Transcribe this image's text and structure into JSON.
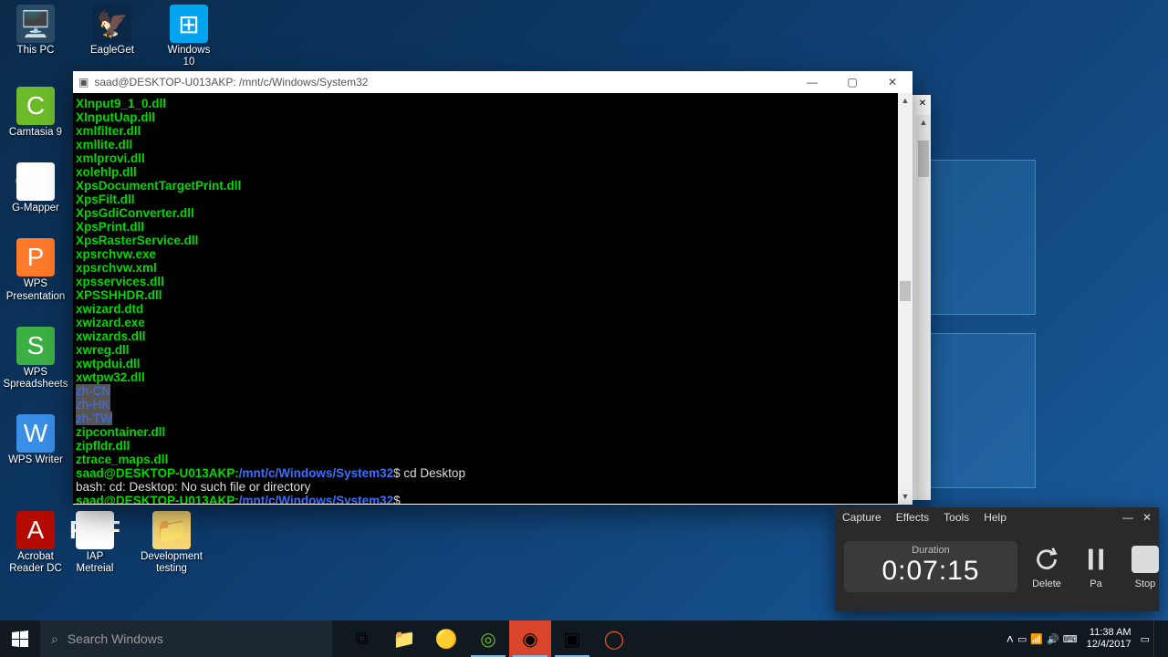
{
  "desktop_icons": {
    "row1": [
      "This PC",
      "EagleGet",
      "Windows 10"
    ],
    "col": [
      "Camtasia 9",
      "G-Mapper",
      "WPS Presentation",
      "WPS Spreadsheets",
      "WPS Writer"
    ],
    "acrobat": "Acrobat Reader DC",
    "row2": [
      "IAP Metreial",
      "Development testing"
    ]
  },
  "terminal": {
    "title": "saad@DESKTOP-U013AKP: /mnt/c/Windows/System32",
    "listing_green": [
      "XInput9_1_0.dll",
      "XInputUap.dll",
      "xmlfilter.dll",
      "xmllite.dll",
      "xmlprovi.dll",
      "xolehlp.dll",
      "XpsDocumentTargetPrint.dll",
      "XpsFilt.dll",
      "XpsGdiConverter.dll",
      "XpsPrint.dll",
      "XpsRasterService.dll",
      "xpsrchvw.exe",
      "xpsrchvw.xml",
      "xpsservices.dll",
      "XPSSHHDR.dll",
      "xwizard.dtd",
      "xwizard.exe",
      "xwizards.dll",
      "xwreg.dll",
      "xwtpdui.dll",
      "xwtpw32.dll"
    ],
    "listing_blue": [
      "zh-CN",
      "zh-HK",
      "zh-TW"
    ],
    "listing_green2": [
      "zipcontainer.dll",
      "zipfldr.dll",
      "ztrace_maps.dll"
    ],
    "prompt_user": "saad@DESKTOP-U013AKP:",
    "prompt_path": "/mnt/c/Windows/System32",
    "cmd1": "$ cd Desktop",
    "err": "bash: cd: Desktop: No such file or directory",
    "cmd2": "$"
  },
  "recorder": {
    "menus": [
      "Capture",
      "Effects",
      "Tools",
      "Help"
    ],
    "duration_label": "Duration",
    "time": "0:07:15",
    "btn_delete": "Delete",
    "btn_pause": "Pa",
    "btn_stop": "Stop"
  },
  "taskbar": {
    "search_placeholder": "Search Windows",
    "time": "11:38 AM",
    "date": "12/4/2017"
  }
}
